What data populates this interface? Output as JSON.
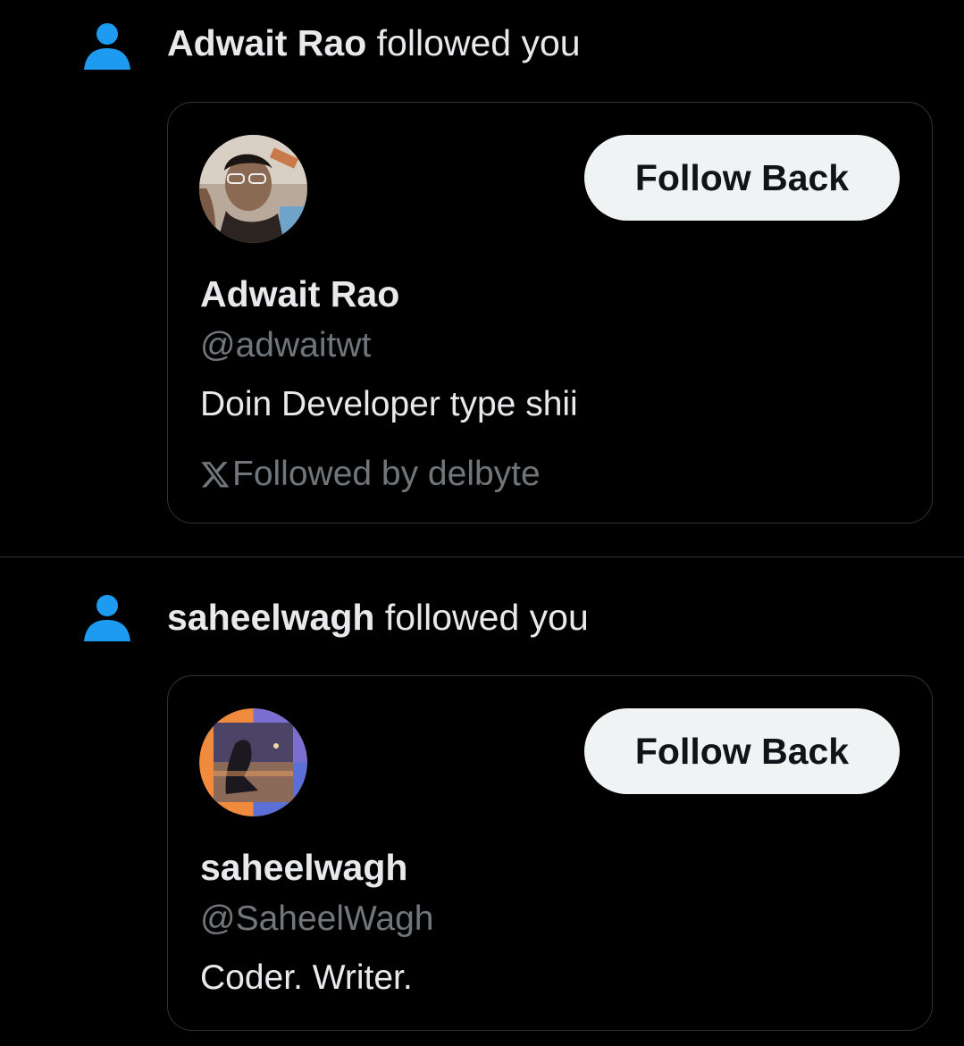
{
  "colors": {
    "background": "#000000",
    "accent_blue": "#1d9bf0",
    "text_primary": "#e7e9ea",
    "text_secondary": "#71767b",
    "border": "#2f3336",
    "button_bg": "#eff3f4"
  },
  "notifications": [
    {
      "icon": "person-icon",
      "actor_name": "Adwait Rao",
      "action_text": "followed you",
      "card": {
        "avatar": "profile-photo",
        "follow_button_label": "Follow Back",
        "display_name": "Adwait Rao",
        "handle": "@adwaitwt",
        "bio": "Doin Developer type shii",
        "followed_by_icon": "x-logo-icon",
        "followed_by_text": "Followed by delbyte"
      }
    },
    {
      "icon": "person-icon",
      "actor_name": "saheelwagh",
      "action_text": "followed you",
      "card": {
        "avatar": "profile-photo",
        "follow_button_label": "Follow Back",
        "display_name": "saheelwagh",
        "handle": "@SaheelWagh",
        "bio": "Coder. Writer."
      }
    }
  ]
}
